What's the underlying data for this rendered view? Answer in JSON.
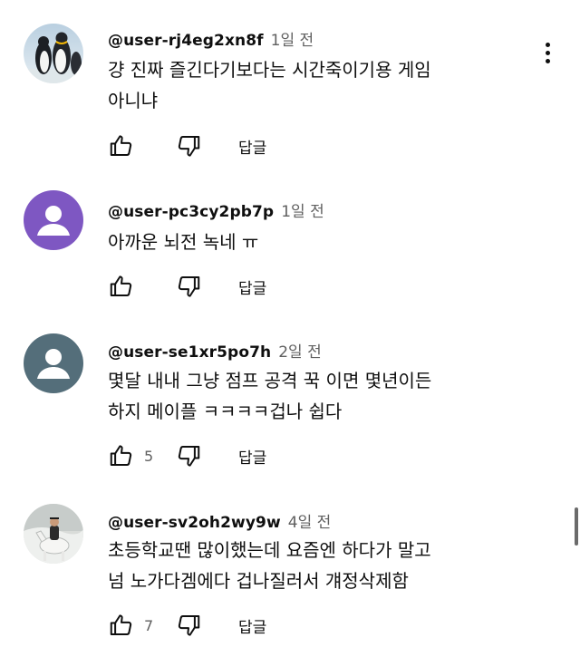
{
  "comments": [
    {
      "author": "@user-rj4eg2xn8f",
      "time": "1일 전",
      "lines": [
        "걍 진짜 즐긴다기보다는 시간죽이기용 게임",
        "아니냐"
      ],
      "likes": "",
      "reply_label": "답글",
      "avatar": "penguins-photo"
    },
    {
      "author": "@user-pc3cy2pb7p",
      "time": "1일 전",
      "lines": [
        "아까운 뇌전 녹네 ㅠ"
      ],
      "likes": "",
      "reply_label": "답글",
      "avatar": "default-avatar-purple",
      "avatar_color": "#7e57c2"
    },
    {
      "author": "@user-se1xr5po7h",
      "time": "2일 전",
      "lines": [
        "몇달 내내 그냥 점프 공격 꾹 이면 몇년이든",
        "하지 메이플 ㅋㅋㅋㅋ겁나 쉽다"
      ],
      "likes": "5",
      "reply_label": "답글",
      "avatar": "default-avatar-slate",
      "avatar_color": "#546e7a"
    },
    {
      "author": "@user-sv2oh2wy9w",
      "time": "4일 전",
      "lines": [
        "초등학교땐 많이했는데 요즘엔 하다가 말고",
        "넘 노가다겜에다 겁나질러서 걔정삭제함"
      ],
      "likes": "7",
      "reply_label": "답글",
      "avatar": "rider-on-white-horse-photo"
    }
  ],
  "icons": {
    "like": "thumbs-up-icon",
    "dislike": "thumbs-down-icon",
    "more": "more-vertical-icon"
  }
}
